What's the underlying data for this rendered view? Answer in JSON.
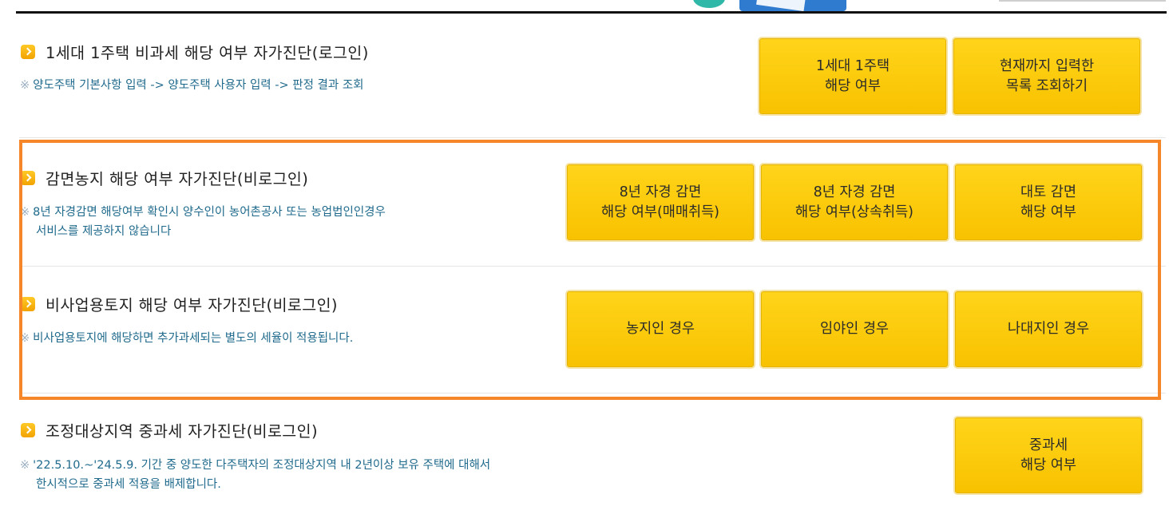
{
  "colors": {
    "highlight": "#f5872a",
    "button": "#f8c200",
    "note": "#1f6a8c",
    "bullet": "#f2a300"
  },
  "sections": [
    {
      "title": "1세대 1주택 비과세 해당 여부 자가진단(로그인)",
      "note_mark": "※",
      "note_lines": [
        "양도주택 기본사항 입력 -> 양도주택 사용자 입력 -> 판정 결과 조회"
      ],
      "buttons": [
        "1세대 1주택\n해당 여부",
        "현재까지 입력한\n목록 조회하기"
      ]
    },
    {
      "title": "감면농지 해당 여부 자가진단(비로그인)",
      "note_mark": "※",
      "note_lines": [
        "8년 자경감면 해당여부 확인시 양수인이 농어촌공사 또는 농업법인인경우",
        "서비스를 제공하지 않습니다"
      ],
      "buttons": [
        "8년 자경 감면\n해당 여부(매매취득)",
        "8년 자경 감면\n해당 여부(상속취득)",
        "대토 감면\n해당 여부"
      ]
    },
    {
      "title": "비사업용토지 해당 여부 자가진단(비로그인)",
      "note_mark": "※",
      "note_lines": [
        "비사업용토지에 해당하면 추가과세되는 별도의 세율이 적용됩니다."
      ],
      "buttons": [
        "농지인 경우",
        "임야인 경우",
        "나대지인 경우"
      ]
    },
    {
      "title": "조정대상지역 중과세 자가진단(비로그인)",
      "note_mark": "※",
      "note_lines": [
        "'22.5.10.~'24.5.9. 기간 중 양도한 다주택자의 조정대상지역 내 2년이상 보유 주택에 대해서",
        "한시적으로 중과세 적용을 배제합니다."
      ],
      "buttons": [
        "중과세\n해당 여부"
      ]
    }
  ]
}
